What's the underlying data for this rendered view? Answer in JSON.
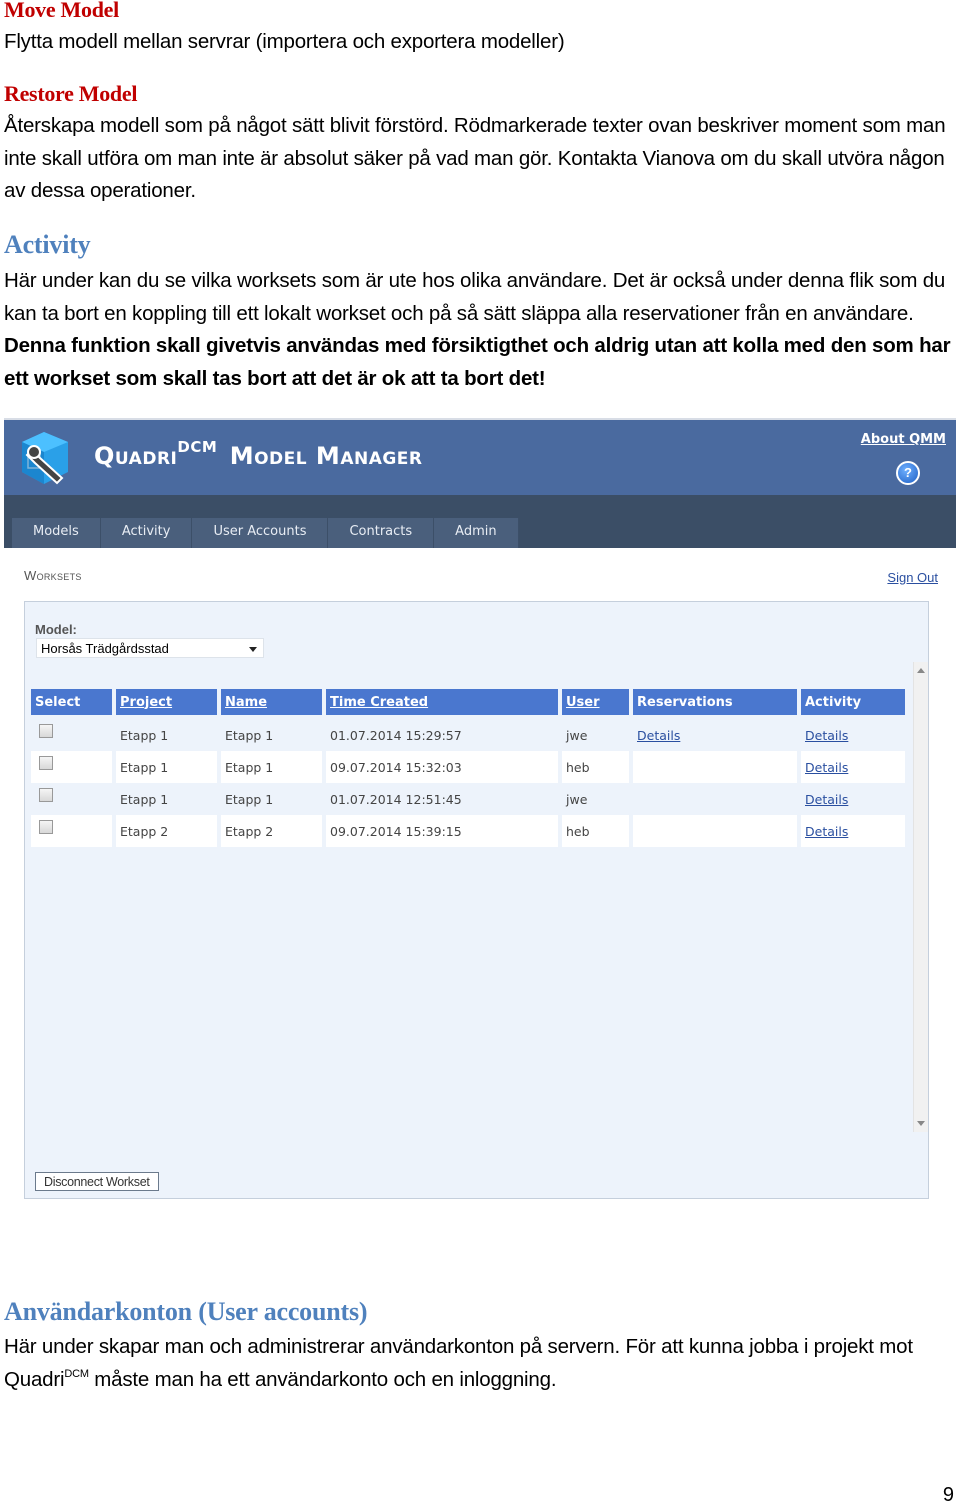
{
  "document": {
    "move_model": {
      "heading": "Move Model",
      "text": "Flytta modell mellan servrar (importera och exportera modeller)"
    },
    "restore_model": {
      "heading": "Restore Model",
      "text": "Återskapa modell som på något sätt blivit förstörd. Rödmarkerade texter ovan beskriver moment som man inte skall utföra om man inte är absolut säker på vad man gör. Kontakta Vianova om du skall utvöra någon av dessa operationer."
    },
    "activity": {
      "heading": "Activity",
      "text": "Här under kan du se vilka worksets som är ute hos olika användare. Det är också under denna flik som du kan ta bort en koppling till ett lokalt workset och på så sätt släppa alla reservationer från en användare. ",
      "bold_text": "Denna funktion skall givetvis användas med försiktigthet och aldrig utan att kolla med den som har ett workset som skall tas bort att det är ok att ta bort det!"
    },
    "user_accounts": {
      "heading": "Användarkonton (User accounts)",
      "text_before": "Här under skapar man och administrerar användarkonton på servern. För att kunna jobba i projekt mot Quadri",
      "superscript": "DCM",
      "text_after": " måste man ha ett användarkonto och en inloggning."
    },
    "page_number": "9"
  },
  "app": {
    "title_main": "Quadri",
    "title_sup": "DCM",
    "title_rest": "Model Manager",
    "about_link": "About QMM",
    "help_icon_label": "?",
    "nav_tabs": [
      {
        "label": "Models"
      },
      {
        "label": "Activity"
      },
      {
        "label": "User Accounts"
      },
      {
        "label": "Contracts"
      },
      {
        "label": "Admin"
      }
    ],
    "section_title": "Worksets",
    "sign_out": "Sign Out",
    "model_label": "Model:",
    "model_selected": "Horsås Trädgårdsstad",
    "table": {
      "headers": [
        "Select",
        "Project",
        "Name",
        "Time Created",
        "User",
        "Reservations",
        "Activity"
      ],
      "rows": [
        {
          "checked": false,
          "project": "Etapp 1",
          "name": "Etapp 1",
          "time_created": "01.07.2014 15:29:57",
          "user": "jwe",
          "reservations": "Details",
          "activity": "Details"
        },
        {
          "checked": false,
          "project": "Etapp 1",
          "name": "Etapp 1",
          "time_created": "09.07.2014 15:32:03",
          "user": "heb",
          "reservations": "",
          "activity": "Details"
        },
        {
          "checked": false,
          "project": "Etapp 1",
          "name": "Etapp 1",
          "time_created": "01.07.2014 12:51:45",
          "user": "jwe",
          "reservations": "",
          "activity": "Details"
        },
        {
          "checked": false,
          "project": "Etapp 2",
          "name": "Etapp 2",
          "time_created": "09.07.2014 15:39:15",
          "user": "heb",
          "reservations": "",
          "activity": "Details"
        }
      ]
    },
    "disconnect_button": "Disconnect Workset",
    "colors": {
      "header_bg": "#4a6a9f",
      "nav_bg": "#3b4e66",
      "grid_header_bg": "#4a77cf",
      "panel_bg": "#edf3fb",
      "link": "#2a4fa0",
      "heading_red": "#c00000",
      "heading_blue": "#4f81bd"
    }
  }
}
